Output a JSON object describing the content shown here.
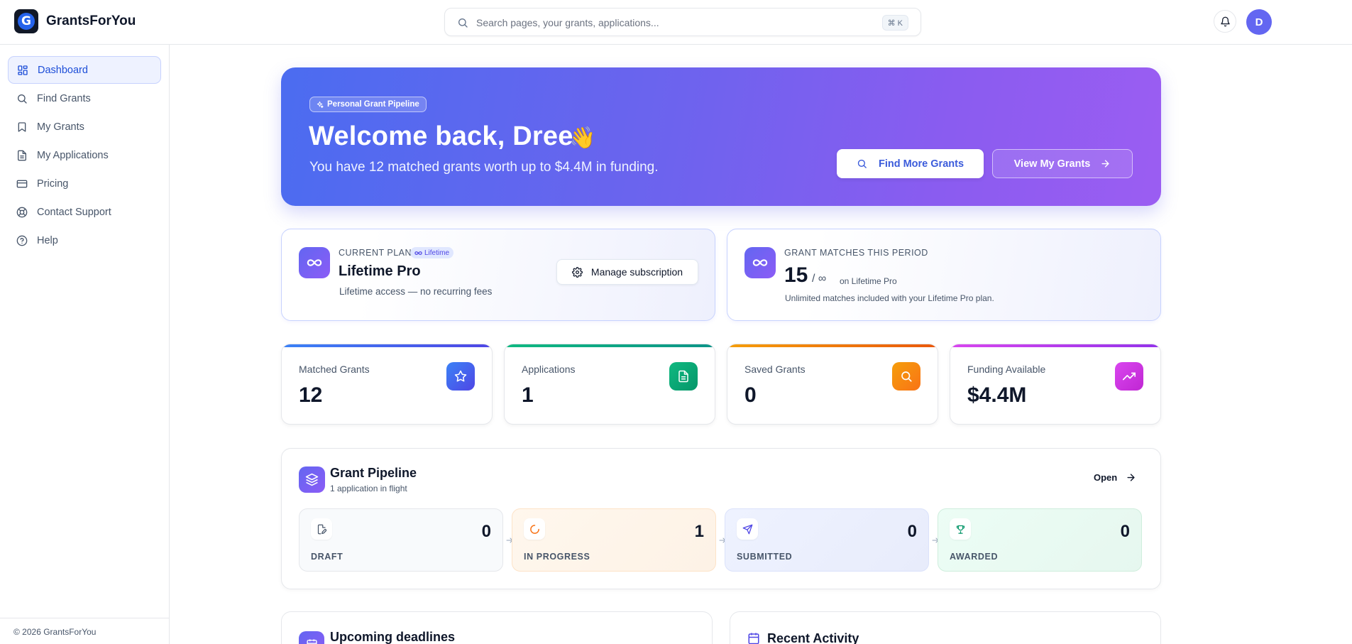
{
  "app": {
    "brand": "GrantsForYou",
    "logo_letter": "G"
  },
  "search": {
    "placeholder": "Search pages, your grants, applications...",
    "shortcut": "⌘ K"
  },
  "user": {
    "avatar_initial": "D"
  },
  "sidebar": {
    "items": [
      {
        "label": "Dashboard",
        "icon": "grid-icon",
        "active": true
      },
      {
        "label": "Find Grants",
        "icon": "search-icon"
      },
      {
        "label": "My Grants",
        "icon": "bookmark-icon"
      },
      {
        "label": "My Applications",
        "icon": "document-icon"
      },
      {
        "label": "Pricing",
        "icon": "credit-card-icon"
      },
      {
        "label": "Contact Support",
        "icon": "lifebuoy-icon"
      },
      {
        "label": "Help",
        "icon": "help-circle-icon"
      }
    ],
    "footer": "© 2026 GrantsForYou"
  },
  "hero": {
    "badge": "Personal Grant Pipeline",
    "title": "Welcome back, Dree",
    "emoji": "👋",
    "subtitle": "You have 12 matched grants worth up to $4.4M in funding.",
    "primary_button": "Find More Grants",
    "secondary_button": "View My Grants"
  },
  "plan": {
    "label": "CURRENT PLAN",
    "pill": "Lifetime",
    "name": "Lifetime Pro",
    "description": "Lifetime access — no recurring fees",
    "manage_button": "Manage subscription"
  },
  "matches": {
    "label": "GRANT MATCHES THIS PERIOD",
    "count": "15",
    "limit": "/ ∞",
    "plan_note": "on Lifetime Pro",
    "description": "Unlimited matches included with your Lifetime Pro plan."
  },
  "stats": [
    {
      "label": "Matched Grants",
      "value": "12",
      "icon": "star-icon",
      "color": "#3b5bdb"
    },
    {
      "label": "Applications",
      "value": "1",
      "icon": "file-text-icon",
      "color": "#0f9f7a"
    },
    {
      "label": "Saved Grants",
      "value": "0",
      "icon": "search-icon",
      "color": "#f97316"
    },
    {
      "label": "Funding Available",
      "value": "$4.4M",
      "icon": "trending-up-icon",
      "color": "#c026d3"
    }
  ],
  "pipeline": {
    "title": "Grant Pipeline",
    "subtitle": "1 application in flight",
    "open_label": "Open",
    "stages": [
      {
        "label": "DRAFT",
        "count": "0",
        "icon": "file-edit-icon"
      },
      {
        "label": "IN PROGRESS",
        "count": "1",
        "icon": "loader-icon"
      },
      {
        "label": "SUBMITTED",
        "count": "0",
        "icon": "send-icon"
      },
      {
        "label": "AWARDED",
        "count": "0",
        "icon": "trophy-icon"
      }
    ]
  },
  "bottom": {
    "deadlines_title": "Upcoming deadlines",
    "activity_title": "Recent Activity"
  }
}
